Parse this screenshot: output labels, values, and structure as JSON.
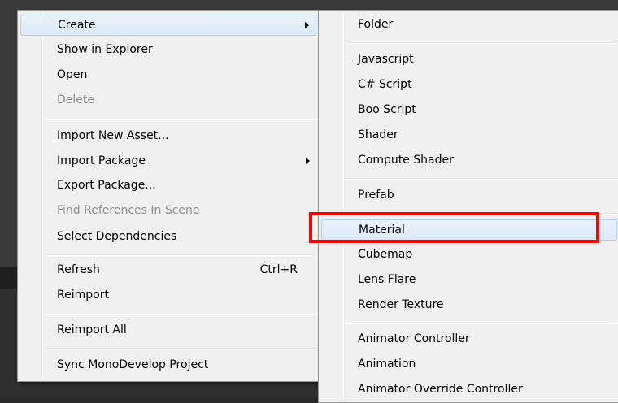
{
  "context_menu": {
    "items": [
      {
        "label": "Create",
        "has_submenu": true
      },
      {
        "label": "Show in Explorer"
      },
      {
        "label": "Open"
      },
      {
        "label": "Delete",
        "disabled": true
      },
      {
        "label": "Import New Asset..."
      },
      {
        "label": "Import Package",
        "has_submenu": true
      },
      {
        "label": "Export Package..."
      },
      {
        "label": "Find References In Scene",
        "disabled": true
      },
      {
        "label": "Select Dependencies"
      },
      {
        "label": "Refresh",
        "shortcut": "Ctrl+R"
      },
      {
        "label": "Reimport"
      },
      {
        "label": "Reimport All"
      },
      {
        "label": "Sync MonoDevelop Project"
      }
    ]
  },
  "create_submenu": {
    "items": [
      {
        "label": "Folder"
      },
      {
        "label": "Javascript"
      },
      {
        "label": "C# Script"
      },
      {
        "label": "Boo Script"
      },
      {
        "label": "Shader"
      },
      {
        "label": "Compute Shader"
      },
      {
        "label": "Prefab"
      },
      {
        "label": "Material",
        "highlighted": true
      },
      {
        "label": "Cubemap"
      },
      {
        "label": "Lens Flare"
      },
      {
        "label": "Render Texture"
      },
      {
        "label": "Animator Controller"
      },
      {
        "label": "Animation"
      },
      {
        "label": "Animator Override Controller"
      }
    ]
  },
  "colors": {
    "highlight_border": "#ff0000",
    "menu_background": "#f0f0f0",
    "hover_background": "#dbe9f8"
  }
}
